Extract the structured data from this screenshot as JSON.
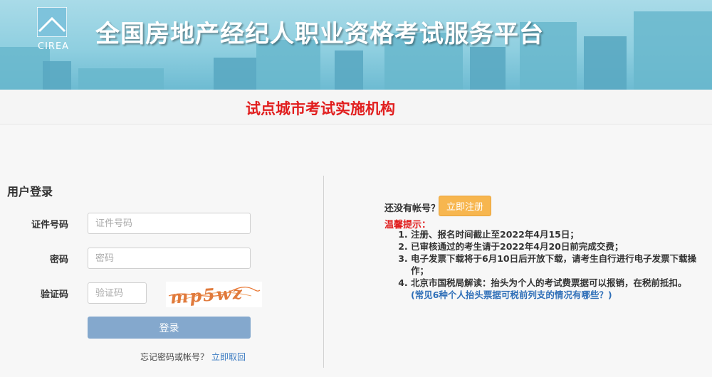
{
  "header": {
    "logo_text": "CIREA",
    "site_title": "全国房地产经纪人职业资格考试服务平台",
    "org_title": "试点城市考试实施机构"
  },
  "login": {
    "heading": "用户登录",
    "id_label": "证件号码",
    "id_placeholder": "证件号码",
    "password_label": "密码",
    "password_placeholder": "密码",
    "captcha_label": "验证码",
    "captcha_placeholder": "验证码",
    "captcha_text": "mp5wz",
    "submit_label": "登录",
    "forgot_text": "忘记密码或帐号？",
    "forgot_link": "立即取回"
  },
  "register": {
    "no_account_text": "还没有帐号？",
    "register_button": "立即注册"
  },
  "tips": {
    "label": "温馨提示：",
    "items": [
      "注册、报名时间截止至2022年4月15日；",
      "已审核通过的考生请于2022年4月20日前完成交费；",
      "电子发票下载将于6月10日后开放下载，请考生自行进行电子发票下载操作；",
      "北京市国税局解读：抬头为个人的考试费票据可以报销，在税前抵扣。"
    ],
    "link_open": "(",
    "link_text": "常见6种个人抬头票据可税前列支的情况有哪些？",
    "link_close": ")"
  },
  "colors": {
    "banner": "#8fcfe0",
    "title_red": "#e11e1e",
    "login_button": "#84a8cd",
    "register_button": "#f7b64f",
    "link_blue": "#3d7cc2"
  }
}
